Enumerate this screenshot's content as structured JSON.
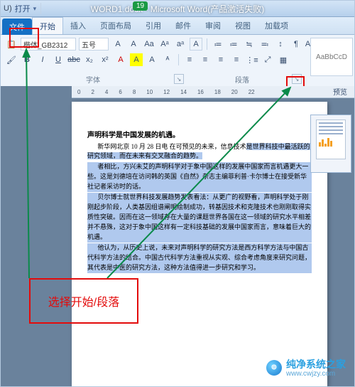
{
  "colors": {
    "accent_red": "#e30b0b",
    "ribbon_blue": "#1570c4",
    "selection": "#b0c9ee"
  },
  "titlebar": {
    "menu_u": "U)",
    "open": "打开",
    "arrow": "▾",
    "pill": "19",
    "title": "WORD1.docx - Microsoft Word(产品激活失败)"
  },
  "tabs": {
    "file": "文件",
    "items": [
      "开始",
      "插入",
      "页面布局",
      "引用",
      "邮件",
      "审阅",
      "视图",
      "加载项"
    ],
    "active_index": 0
  },
  "ribbon": {
    "font_name": "楷体_GB2312",
    "font_size": "五号",
    "buttons_row1": [
      "A",
      "A",
      "Aa",
      "Aᵃ",
      "aᵃ",
      "A"
    ],
    "buttons_row2": [
      "B",
      "I",
      "U",
      "abc",
      "x₂",
      "x²",
      "A",
      "A",
      "A",
      "ᴬ"
    ],
    "para_row1": [
      "≔",
      "≔",
      "≒",
      "≕",
      "↕",
      "¶",
      "✕",
      "AᵃZ",
      "↧"
    ],
    "para_row2": [
      "≡",
      "≡",
      "≡",
      "≡",
      "⋮≡",
      "⤢",
      "▦"
    ],
    "group_font": "字体",
    "group_para": "段落",
    "styles_preview": "AaBbCcD",
    "launcher_glyph": "↘"
  },
  "ruler": [
    "0",
    "2",
    "4",
    "6",
    "8",
    "10",
    "12",
    "14",
    "16",
    "18",
    "20",
    "22"
  ],
  "thumbnail_label": "预览",
  "document": {
    "title": "声明科学是中国发展的机遇。",
    "p1_a": "新华网北京 10 月 28 日电  在可预见的未来，信息技术",
    "p1_b": "是世界科技中最活跃的研究领域，而在未来有交叉融合的趋势。",
    "p2": "者相比，方兴未艾的声明科学对于象中国这样的发展中国家而言机遇更大一些。这是刘德培在访问韩的英国《自然》杂志主编菲利普·卡尔博士在接受新华社记者采访时的话。",
    "p3": "贝尔博士就世界科技发展趋势发表看法：从更广的视野看，声明科学处于刚刚起步阶段，人类基因组谱阐明绘制成功，转基因技术和克隆技术也刚刚取得实质性突破。因而在这一领域存在大量的课题世界各国在这一领域的研究水平相差并不悬殊，这对于象中国这样有一定科技基础的发展中国家而言，意味着巨大的机遇。",
    "p4": "他认为，从历史上说，未来对声明科学的研究方法是西方科学方法与中国古代科学方法的结合。中国古代科学方法重视从实观、综合考虑角度来研究问题，其代表是中医的研究方法，这种方法值得进一步研究和学习。"
  },
  "annotation": {
    "text": "选择开始/段落"
  },
  "watermark": {
    "name": "纯净系统之家",
    "url": "www.cwjzy.com"
  }
}
